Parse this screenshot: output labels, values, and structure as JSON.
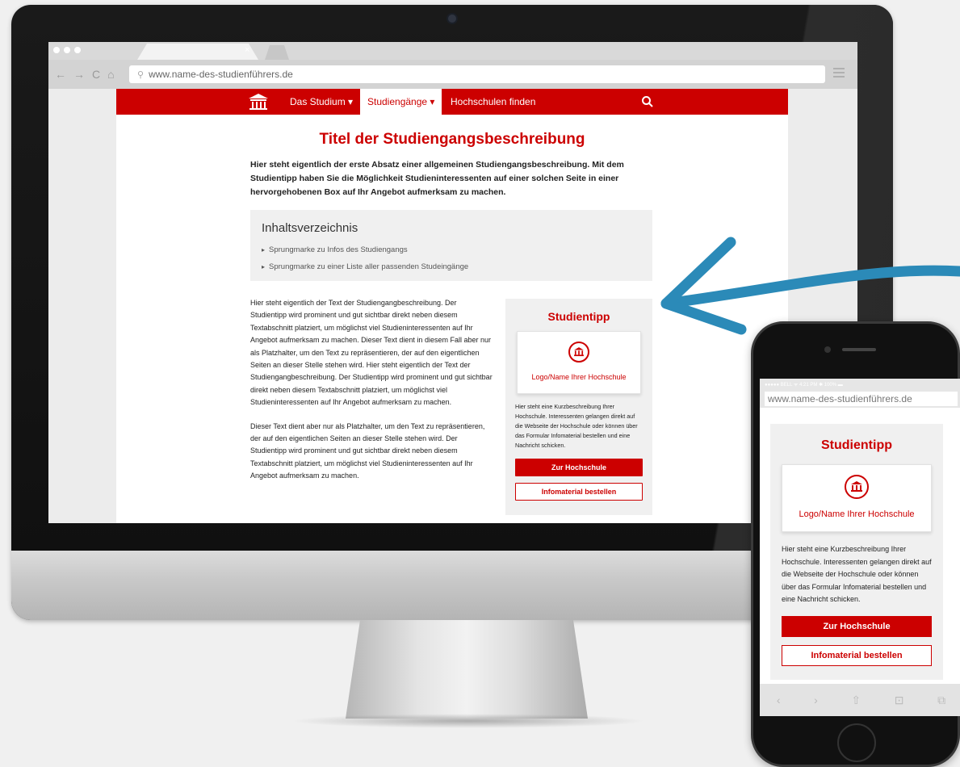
{
  "browser": {
    "tab_close": "×",
    "url": "www.name-des-studienführers.de",
    "nav_back": "←",
    "nav_forward": "→",
    "nav_reload": "C",
    "nav_home": "⌂"
  },
  "site": {
    "brand_color": "#cc0000",
    "nav": [
      {
        "label": "Das Studium ▾"
      },
      {
        "label": "Studiengänge ▾"
      },
      {
        "label": "Hochschulen finden"
      }
    ],
    "title": "Titel der Studiengangsbeschreibung",
    "intro": "Hier steht eigentlich der erste Absatz einer allgemeinen Studiengangsbeschreibung. Mit dem Studientipp haben Sie die Möglichkeit Studieninteressenten auf einer solchen Seite in einer hervorgehobenen Box auf Ihr Angebot aufmerksam zu machen.",
    "toc": {
      "title": "Inhaltsverzeichnis",
      "items": [
        "Sprungmarke zu Infos des Studiengangs",
        "Sprungmarke zu einer Liste aller passenden Studeingänge"
      ]
    },
    "body": [
      "Hier steht eigentlich der Text der Studiengangbeschreibung. Der Studientipp wird prominent und gut sichtbar direkt neben diesem Textabschnitt platziert, um möglichst viel Studieninteressenten auf Ihr Angebot aufmerksam zu machen. Dieser Text dient in diesem Fall aber nur als Platzhalter, um den Text zu repräsentieren, der auf den eigentlichen Seiten an dieser Stelle stehen wird. Hier steht eigentlich der Text der Studiengangbeschreibung. Der Studientipp wird prominent und gut sichtbar direkt neben diesem Textabschnitt platziert, um möglichst viel Studieninteressenten auf Ihr Angebot aufmerksam zu machen.",
      "Dieser Text dient aber nur als Platzhalter, um den Text zu repräsentieren, der auf den eigentlichen Seiten an dieser Stelle stehen wird. Der Studientipp wird prominent und gut sichtbar direkt neben diesem Textabschnitt platziert, um möglichst viel Studieninteressenten auf Ihr Angebot aufmerksam zu machen."
    ]
  },
  "tip": {
    "title": "Studientipp",
    "logo_label": "Logo/Name Ihrer Hochschule",
    "description": "Hier steht eine Kurzbeschreibung Ihrer Hochschule. Interessenten gelangen direkt auf die Webseite der Hochschule oder können über das Formular Infomaterial bestellen und eine Nachricht schicken.",
    "primary_button": "Zur Hochschule",
    "secondary_button": "Infomaterial bestellen"
  },
  "phone": {
    "status": "●●●●● BELL ᯤ        4:21 PM        ✱ 100% ▬",
    "url": "www.name-des-studienführers.de",
    "bottom_icons": [
      "‹",
      "›",
      "⇧",
      "⊡",
      "⧉"
    ]
  },
  "accent": {
    "arrow_color": "#2b8ab8"
  }
}
